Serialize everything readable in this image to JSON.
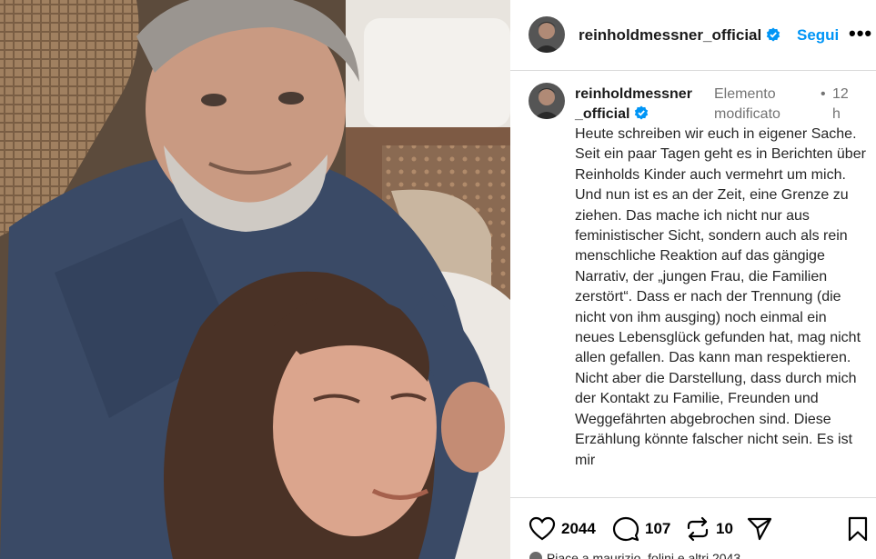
{
  "post": {
    "username": "reinholdmessner_official",
    "follow_label": "Segui",
    "more_label": "•••"
  },
  "caption": {
    "username": "reinholdmessner_official",
    "edited_label": "Elemento modificato",
    "separator": "•",
    "time": "12 h",
    "text": "Heute schreiben wir euch in eigener Sache. Seit ein paar Tagen geht es in Berichten über Reinholds Kinder auch vermehrt um mich. Und nun ist es an der Zeit, eine Grenze zu ziehen. Das mache ich nicht nur aus feministischer Sicht, sondern auch als rein menschliche Reaktion auf das gängige Narrativ, der „jungen Frau, die Familien zerstört“. Dass er nach der Trennung (die nicht von ihm ausging) noch einmal ein neues Lebensglück gefunden hat, mag nicht allen gefallen. Das kann man respektieren. Nicht aber die Darstellung, dass durch mich der Kontakt zu Familie, Freunden und Weggefährten abgebrochen sind. Diese Erzählung könnte falscher nicht sein. Es ist mir"
  },
  "actions": {
    "likes": "2044",
    "comments": "107",
    "reposts": "10",
    "liked_by": "Piace a maurizio_folini e altri 2043"
  },
  "icons": {
    "verified": "verified-badge-icon",
    "like": "heart-icon",
    "comment": "comment-icon",
    "repost": "repost-icon",
    "share": "share-icon",
    "save": "bookmark-icon",
    "more": "more-icon"
  },
  "colors": {
    "accent": "#0095f6",
    "muted": "#737373",
    "border": "#dbdbdb"
  }
}
